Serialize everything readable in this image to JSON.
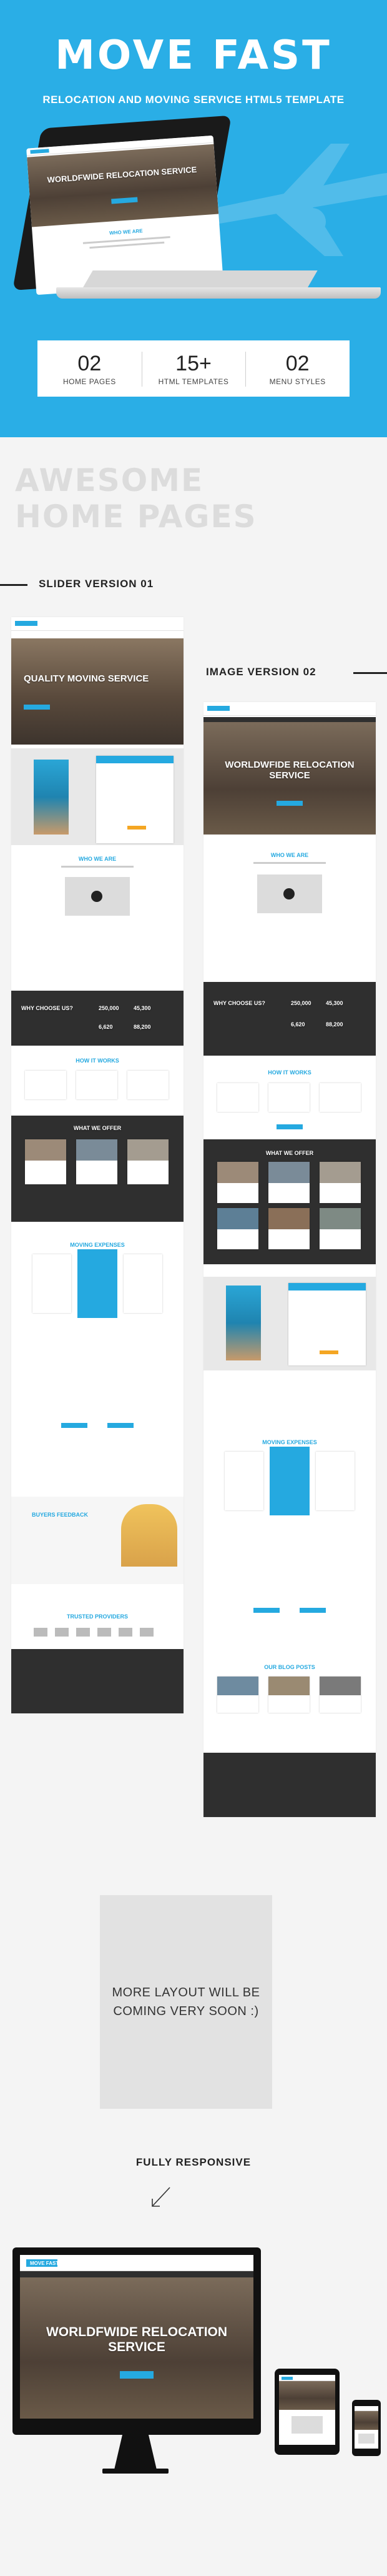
{
  "hero": {
    "title": "MOVE FAST",
    "subtitle": "RELOCATION AND MOVING SERVICE HTML5 TEMPLATE",
    "stats": [
      {
        "num": "02",
        "label": "HOME PAGES"
      },
      {
        "num": "15+",
        "label": "HTML TEMPLATES"
      },
      {
        "num": "02",
        "label": "MENU STYLES"
      }
    ],
    "laptop_screen": {
      "heading": "WORLDFWIDE RELOCATION SERVICE",
      "sub": "WHO WE ARE"
    }
  },
  "awesome": {
    "line1": "AWESOME",
    "line2": "HOME PAGES"
  },
  "slider_version": {
    "label": "SLIDER VERSION 01",
    "hero_text": "QUALITY MOVING SERVICE",
    "sections": [
      "WHO WE ARE",
      "WHY CHOOSE US?",
      "HOW IT WORKS",
      "WHAT WE OFFER",
      "MOVING EXPENSES",
      "BUYERS FEEDBACK",
      "TRUSTED PROVIDERS"
    ],
    "counters": [
      "250,000",
      "45,300",
      "6,620",
      "88,200"
    ]
  },
  "image_version": {
    "label": "IMAGE VERSION 02",
    "hero_text": "WORLDWFIDE RELOCATION SERVICE",
    "sections": [
      "WHO WE ARE",
      "WHY CHOOSE US?",
      "HOW IT WORKS",
      "WHAT WE OFFER",
      "MOVING EXPENSES",
      "OUR BLOG POSTS"
    ],
    "counters": [
      "250,000",
      "45,300",
      "6,620",
      "88,200"
    ]
  },
  "coming": {
    "line1": "MORE LAYOUT  WILL  BE",
    "line2": "COMING VERY SOON :)"
  },
  "responsive": {
    "label": "FULLY RESPONSIVE",
    "monitor_heading": "WORLDFWIDE RELOCATION SERVICE",
    "brand": "MOVE FAST"
  },
  "colors": {
    "brand": "#25a9e0",
    "hero_bg": "#2aaee6",
    "accent": "#f4a623",
    "dark": "#2f2f2f"
  }
}
